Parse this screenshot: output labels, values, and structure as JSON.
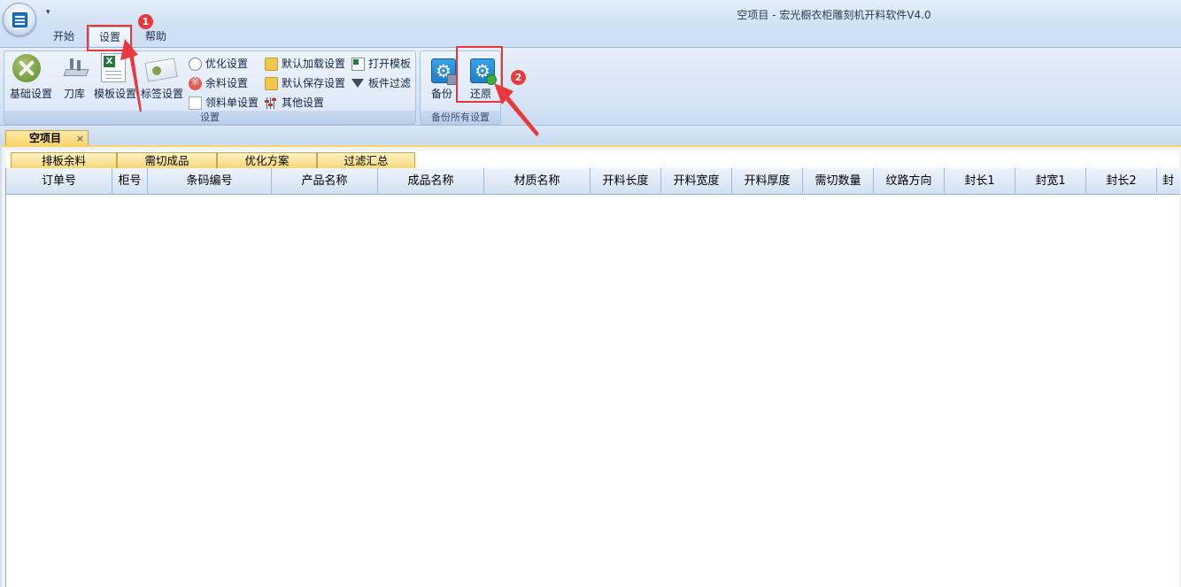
{
  "window": {
    "title": "空项目 - 宏光橱衣柜雕刻机开料软件V4.0",
    "qat_arrow": "▾"
  },
  "ribbon_tabs": [
    {
      "label": "开始"
    },
    {
      "label": "设置"
    },
    {
      "label": "帮助"
    }
  ],
  "ribbon": {
    "settings_group": {
      "label": "设置",
      "large_buttons": [
        {
          "label": "基础设置",
          "icon": "tools-icon"
        },
        {
          "label": "刀库",
          "icon": "knife-icon"
        },
        {
          "label": "模板设置",
          "icon": "excel-template-icon"
        },
        {
          "label": "标签设置",
          "icon": "label-icon"
        }
      ],
      "small_buttons": [
        {
          "label": "优化设置",
          "icon": "clock-icon"
        },
        {
          "label": "余料设置",
          "icon": "remnant-icon",
          "glyph": "余"
        },
        {
          "label": "领料单设置",
          "icon": "document-icon"
        },
        {
          "label": "默认加载设置",
          "icon": "folder-load-icon"
        },
        {
          "label": "默认保存设置",
          "icon": "folder-save-icon"
        },
        {
          "label": "其他设置",
          "icon": "sliders-icon"
        },
        {
          "label": "打开模板",
          "icon": "excel-file-icon"
        },
        {
          "label": "板件过滤",
          "icon": "filter-icon"
        }
      ]
    },
    "backup_group": {
      "label": "备份所有设置",
      "buttons": [
        {
          "label": "备份",
          "icon": "gear-backup-icon"
        },
        {
          "label": "还原",
          "icon": "gear-restore-icon"
        }
      ]
    }
  },
  "annotations": {
    "badge_1": "1",
    "badge_2": "2",
    "color": "#e8383b"
  },
  "document_tab": {
    "label": "空项目",
    "close": "×"
  },
  "sub_tabs": [
    {
      "label": "排板余料"
    },
    {
      "label": "需切成品"
    },
    {
      "label": "优化方案"
    },
    {
      "label": "过滤汇总"
    }
  ],
  "grid": {
    "columns": [
      "订单号",
      "柜号",
      "条码编号",
      "产品名称",
      "成品名称",
      "材质名称",
      "开料长度",
      "开料宽度",
      "开料厚度",
      "需切数量",
      "纹路方向",
      "封长1",
      "封宽1",
      "封长2",
      "封"
    ],
    "rows": []
  },
  "colors": {
    "accent": "#1d73c6",
    "tab_yellow": "#f7d36a",
    "header_blue": "#d1e1f4"
  }
}
